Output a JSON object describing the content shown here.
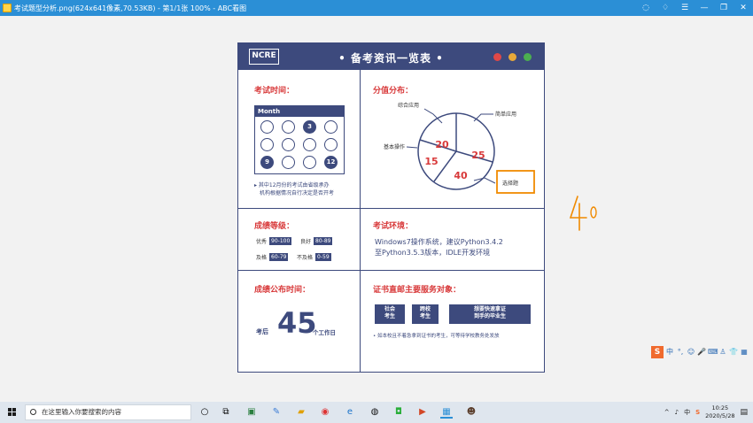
{
  "window": {
    "title": "考试题型分析.png(624x641像素,70.53KB) - 第1/1张 100% - ABC看图",
    "controls": [
      "◌",
      "♢",
      "☰",
      "—",
      "❐",
      "✕"
    ]
  },
  "poster": {
    "logo": "NCRE",
    "title": "• 备考资讯一览表 •",
    "dots": [
      "#e04848",
      "#e8a93a",
      "#4caf50"
    ],
    "exam_time": {
      "heading": "考试时间：",
      "calendar_header": "Month",
      "cells": [
        "",
        "",
        "3",
        "",
        "",
        "",
        "",
        "",
        "9",
        "",
        "",
        "12"
      ],
      "note": [
        "▸ 其中12月份的考试由省级承办",
        "机构根据情况自行决定是否开考"
      ]
    },
    "score_distribution": {
      "heading": "分值分布：",
      "labels": {
        "comprehensive": "综合应用",
        "simple": "简单应用",
        "basic": "基本操作",
        "choice": "选择题"
      },
      "values": {
        "comprehensive": "20",
        "simple": "25",
        "basic": "15",
        "choice": "40"
      }
    },
    "grades": {
      "heading": "成绩等级：",
      "items": [
        {
          "name": "优秀",
          "range": "90-100"
        },
        {
          "name": "良好",
          "range": "80-89"
        },
        {
          "name": "及格",
          "range": "60-79"
        },
        {
          "name": "不及格",
          "range": "0-59"
        }
      ]
    },
    "environment": {
      "heading": "考试环境：",
      "line1": "Windows7操作系统，建议Python3.4.2",
      "line2": "至Python3.5.3版本，IDLE开发环境"
    },
    "publish": {
      "heading": "成绩公布时间：",
      "prefix": "考后",
      "number": "45",
      "suffix": "个工作日"
    },
    "service": {
      "heading": "证书直邮主要服务对象：",
      "tags": [
        [
          "社会",
          "考生"
        ],
        [
          "跨校",
          "考生"
        ],
        [
          "想要快速拿证",
          "到手的毕业生"
        ]
      ],
      "note": "• 如本校且不着急拿到证书的考生，可等待学校教务处发放"
    }
  },
  "annotation": {
    "handwritten": "40",
    "color": "#f08a00"
  },
  "ime": {
    "logo": "S",
    "items": [
      "中",
      "°,",
      "☺",
      "🎤",
      "⌨",
      "♙",
      "👕",
      "▦"
    ]
  },
  "taskbar": {
    "search_placeholder": "在这里输入你要搜索的内容",
    "time": "10:25",
    "date": "2020/5/28",
    "tray_icons": [
      "^",
      "♪",
      "中",
      "S"
    ]
  }
}
